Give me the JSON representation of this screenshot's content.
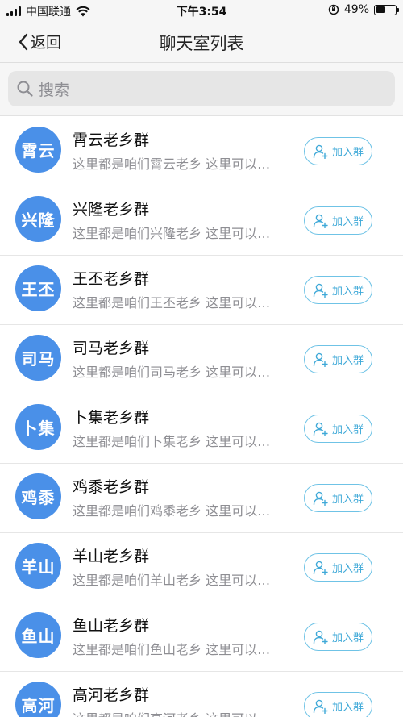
{
  "status_bar": {
    "carrier": "中国联通",
    "time": "下午3:54",
    "battery_percent": "49%",
    "battery_level": 0.49
  },
  "nav": {
    "back_label": "返回",
    "title": "聊天室列表"
  },
  "search": {
    "placeholder": "搜索"
  },
  "colors": {
    "avatar_bg": "#4a90e8",
    "join_border": "#6fc3e6",
    "join_text": "#3fa9d8"
  },
  "join_button_label": "加入群",
  "rooms": [
    {
      "avatar_text": "霄云",
      "name": "霄云老乡群",
      "desc": "这里都是咱们霄云老乡 这里可以…"
    },
    {
      "avatar_text": "兴隆",
      "name": "兴隆老乡群",
      "desc": "这里都是咱们兴隆老乡 这里可以…"
    },
    {
      "avatar_text": "王丕",
      "name": "王丕老乡群",
      "desc": "这里都是咱们王丕老乡 这里可以…"
    },
    {
      "avatar_text": "司马",
      "name": "司马老乡群",
      "desc": "这里都是咱们司马老乡 这里可以…"
    },
    {
      "avatar_text": "卜集",
      "name": "卜集老乡群",
      "desc": "这里都是咱们卜集老乡 这里可以…"
    },
    {
      "avatar_text": "鸡黍",
      "name": "鸡黍老乡群",
      "desc": "这里都是咱们鸡黍老乡 这里可以…"
    },
    {
      "avatar_text": "羊山",
      "name": "羊山老乡群",
      "desc": "这里都是咱们羊山老乡 这里可以…"
    },
    {
      "avatar_text": "鱼山",
      "name": "鱼山老乡群",
      "desc": "这里都是咱们鱼山老乡 这里可以…"
    },
    {
      "avatar_text": "高河",
      "name": "高河老乡群",
      "desc": "这里都是咱们高河老乡 这里可以…"
    }
  ]
}
